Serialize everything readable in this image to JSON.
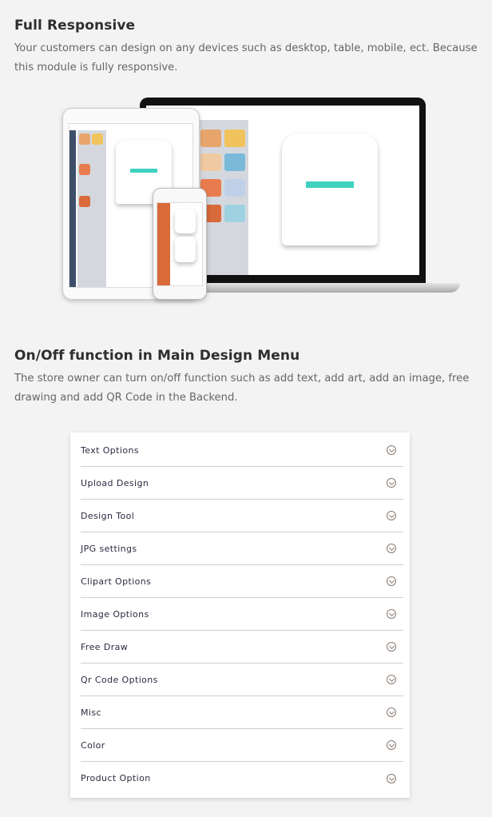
{
  "section1": {
    "title": "Full Responsive",
    "description": "Your customers can design on any devices such as desktop, table, mobile, ect. Because this module is fully responsive."
  },
  "section2": {
    "title": "On/Off function in Main Design Menu",
    "description": "The store owner can turn on/off function such as add text, add art, add an image, free drawing and add QR Code in the Backend."
  },
  "menu": {
    "items": [
      {
        "label": "Text Options"
      },
      {
        "label": "Upload Design"
      },
      {
        "label": "Design Tool"
      },
      {
        "label": "JPG settings"
      },
      {
        "label": "Clipart Options"
      },
      {
        "label": "Image Options"
      },
      {
        "label": "Free Draw"
      },
      {
        "label": "Qr Code Options"
      },
      {
        "label": "Misc"
      },
      {
        "label": "Color"
      },
      {
        "label": "Product Option"
      }
    ],
    "icon": "chevron-down-circle-icon"
  },
  "colors": {
    "accent": "#3fd1c0",
    "heading": "#2e2e2e",
    "text": "#666666"
  }
}
